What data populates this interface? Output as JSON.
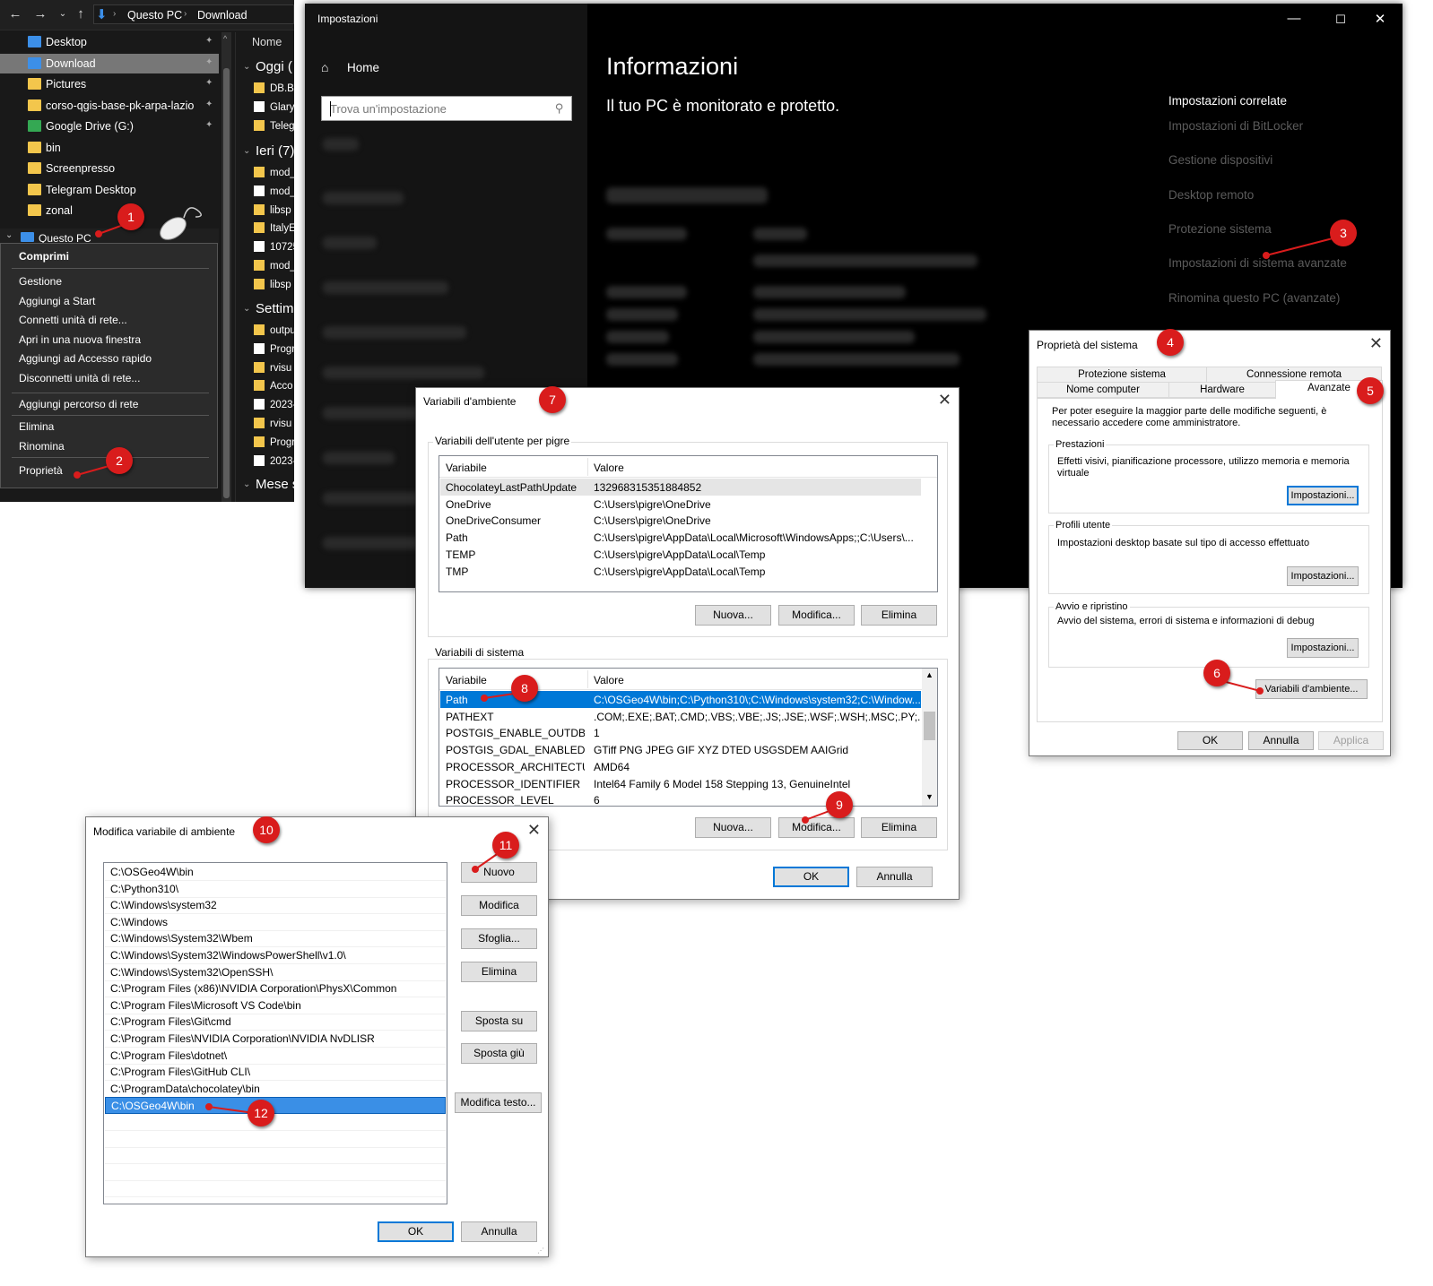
{
  "explorer": {
    "breadcrumb": [
      "Questo PC",
      "Download"
    ],
    "nav_items": [
      {
        "label": "Desktop",
        "icon": "desktop-icon",
        "pinned": true
      },
      {
        "label": "Download",
        "icon": "download-icon",
        "pinned": true,
        "selected": true
      },
      {
        "label": "Pictures",
        "icon": "folder-icon",
        "pinned": true
      },
      {
        "label": "corso-qgis-base-pk-arpa-lazio",
        "icon": "folder-icon",
        "pinned": true
      },
      {
        "label": "Google Drive (G:)",
        "icon": "google-drive-icon",
        "pinned": true
      },
      {
        "label": "bin",
        "icon": "folder-icon"
      },
      {
        "label": "Screenpresso",
        "icon": "folder-icon"
      },
      {
        "label": "Telegram Desktop",
        "icon": "folder-icon"
      },
      {
        "label": "zonal",
        "icon": "folder-icon"
      }
    ],
    "this_pc": "Questo PC",
    "column_name": "Nome",
    "groups": [
      {
        "label": "Oggi (",
        "files": [
          "DB.Br",
          "Glary",
          "Teleg"
        ]
      },
      {
        "label": "Ieri (7)",
        "files": [
          "mod_",
          "mod_",
          "libsp",
          "ItalyE",
          "10725",
          "mod_",
          "libsp"
        ]
      },
      {
        "label": "Settim",
        "files": [
          "outpu",
          "Progr",
          "rvisu",
          "Acco",
          "2023-",
          "rvisu",
          "Progr",
          "2023-"
        ]
      },
      {
        "label": "Mese s",
        "files": []
      }
    ],
    "context_menu": {
      "bold_item": "Comprimi",
      "items_a": [
        "Gestione",
        "Aggiungi a Start",
        "Connetti unità di rete...",
        "Apri in una nuova finestra",
        "Aggiungi ad Accesso rapido",
        "Disconnetti unità di rete..."
      ],
      "items_b": [
        "Aggiungi percorso di rete"
      ],
      "items_c": [
        "Elimina",
        "Rinomina"
      ],
      "items_d": [
        "Proprietà"
      ]
    }
  },
  "settings": {
    "window_title": "Impostazioni",
    "home": "Home",
    "search_placeholder": "Trova un'impostazione",
    "page_title": "Informazioni",
    "subtitle": "Il tuo PC è monitorato e protetto.",
    "related_title": "Impostazioni correlate",
    "related_links": [
      "Impostazioni di BitLocker",
      "Gestione dispositivi",
      "Desktop remoto",
      "Protezione sistema",
      "Impostazioni di sistema avanzate",
      "Rinomina questo PC (avanzate)"
    ]
  },
  "sysprop": {
    "title": "Proprietà del sistema",
    "tabs_row1": [
      "Protezione sistema",
      "Connessione remota"
    ],
    "tabs_row2": [
      "Nome computer",
      "Hardware",
      "Avanzate"
    ],
    "admin_note": "Per poter eseguire la maggior parte delle modifiche seguenti, è necessario accedere come amministratore.",
    "performance": {
      "label": "Prestazioni",
      "desc": "Effetti visivi, pianificazione processore, utilizzo memoria e memoria virtuale",
      "button": "Impostazioni..."
    },
    "profiles": {
      "label": "Profili utente",
      "desc": "Impostazioni desktop basate sul tipo di accesso effettuato",
      "button": "Impostazioni..."
    },
    "startup": {
      "label": "Avvio e ripristino",
      "desc": "Avvio del sistema, errori di sistema e informazioni di debug",
      "button": "Impostazioni..."
    },
    "env_button": "Variabili d'ambiente...",
    "ok": "OK",
    "cancel": "Annulla",
    "apply": "Applica"
  },
  "envvars": {
    "title": "Variabili d'ambiente",
    "user_group": "Variabili dell'utente per pigre",
    "col_var": "Variabile",
    "col_val": "Valore",
    "user_vars": [
      {
        "name": "ChocolateyLastPathUpdate",
        "value": "132968315351884852"
      },
      {
        "name": "OneDrive",
        "value": "C:\\Users\\pigre\\OneDrive"
      },
      {
        "name": "OneDriveConsumer",
        "value": "C:\\Users\\pigre\\OneDrive"
      },
      {
        "name": "Path",
        "value": "C:\\Users\\pigre\\AppData\\Local\\Microsoft\\WindowsApps;;C:\\Users\\..."
      },
      {
        "name": "TEMP",
        "value": "C:\\Users\\pigre\\AppData\\Local\\Temp"
      },
      {
        "name": "TMP",
        "value": "C:\\Users\\pigre\\AppData\\Local\\Temp"
      }
    ],
    "sys_group": "Variabili di sistema",
    "sys_vars": [
      {
        "name": "Path",
        "value": "C:\\OSGeo4W\\bin;C:\\Python310\\;C:\\Windows\\system32;C:\\Window..."
      },
      {
        "name": "PATHEXT",
        "value": ".COM;.EXE;.BAT;.CMD;.VBS;.VBE;.JS;.JSE;.WSF;.WSH;.MSC;.PY;.PYW"
      },
      {
        "name": "POSTGIS_ENABLE_OUTDB_R...",
        "value": "1"
      },
      {
        "name": "POSTGIS_GDAL_ENABLED_D...",
        "value": "GTiff PNG JPEG GIF XYZ DTED USGSDEM AAIGrid"
      },
      {
        "name": "PROCESSOR_ARCHITECTURE",
        "value": "AMD64"
      },
      {
        "name": "PROCESSOR_IDENTIFIER",
        "value": "Intel64 Family 6 Model 158 Stepping 13, GenuineIntel"
      },
      {
        "name": "PROCESSOR_LEVEL",
        "value": "6"
      }
    ],
    "new": "Nuova...",
    "edit": "Modifica...",
    "delete": "Elimina",
    "ok": "OK",
    "cancel": "Annulla"
  },
  "editvar": {
    "title": "Modifica variabile di ambiente",
    "entries": [
      "C:\\OSGeo4W\\bin",
      "C:\\Python310\\",
      "C:\\Windows\\system32",
      "C:\\Windows",
      "C:\\Windows\\System32\\Wbem",
      "C:\\Windows\\System32\\WindowsPowerShell\\v1.0\\",
      "C:\\Windows\\System32\\OpenSSH\\",
      "C:\\Program Files (x86)\\NVIDIA Corporation\\PhysX\\Common",
      "C:\\Program Files\\Microsoft VS Code\\bin",
      "C:\\Program Files\\Git\\cmd",
      "C:\\Program Files\\NVIDIA Corporation\\NVIDIA NvDLISR",
      "C:\\Program Files\\dotnet\\",
      "C:\\Program Files\\GitHub CLI\\",
      "C:\\ProgramData\\chocolatey\\bin",
      "C:\\OSGeo4W\\bin"
    ],
    "buttons": {
      "new": "Nuovo",
      "edit": "Modifica",
      "browse": "Sfoglia...",
      "delete": "Elimina",
      "up": "Sposta su",
      "down": "Sposta giù",
      "edit_text": "Modifica testo..."
    },
    "ok": "OK",
    "cancel": "Annulla"
  },
  "markers": [
    "1",
    "2",
    "3",
    "4",
    "5",
    "6",
    "7",
    "8",
    "9",
    "10",
    "11",
    "12"
  ],
  "colors": {
    "marker": "#d91c1c",
    "selection": "#0078d7",
    "explorer_bg": "#191919"
  }
}
